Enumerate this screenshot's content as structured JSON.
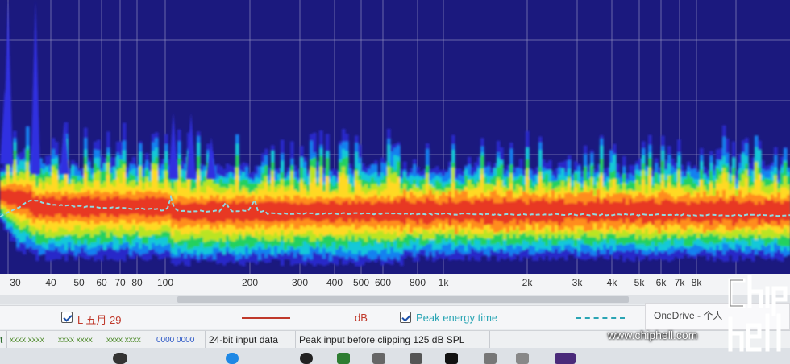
{
  "plot": {
    "x_axis_scale": "log",
    "x_range_hz": [
      25,
      20000
    ],
    "peak_energy_time_color": "#8fd9df",
    "background_color": "#14127a"
  },
  "axis": {
    "tick_labels": [
      "30",
      "40",
      "50",
      "60",
      "70",
      "80",
      "100",
      "200",
      "300",
      "400",
      "500",
      "600",
      "800",
      "1k",
      "2k",
      "3k",
      "4k",
      "5k",
      "6k",
      "7k",
      "8k"
    ]
  },
  "legend": {
    "series1_label": "L 五月 29",
    "series1_color": "#c0392b",
    "series1_unit": "dB",
    "series2_label": "Peak energy time",
    "series2_color": "#2aa5b4"
  },
  "toast": {
    "text": "OneDrive - 个人"
  },
  "status": {
    "meter1": "xxxx xxxx",
    "meter2": "xxxx xxxx",
    "meter3": "xxxx xxxx",
    "meter4": "0000 0000",
    "input_format": "24-bit input data",
    "clipping": "Peak input before clipping 125 dB SPL"
  },
  "watermark": {
    "url": "www.chiphell.com",
    "logo": "chip hell"
  }
}
